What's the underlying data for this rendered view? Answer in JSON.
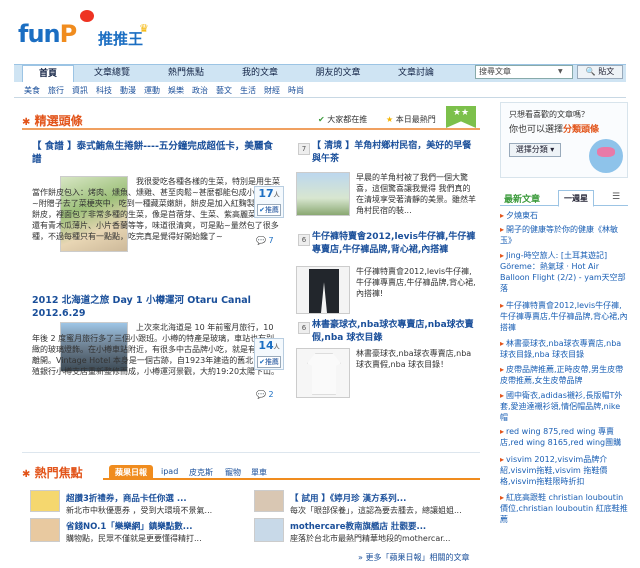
{
  "logo": {
    "fun": "fun",
    "p": "P",
    "zh": "推推王"
  },
  "nav": {
    "tabs": [
      "首頁",
      "文章總覽",
      "熱門焦點",
      "我的文章",
      "朋友的文章",
      "文章討論"
    ],
    "search_placeholder": "搜尋文章",
    "search_button": "貼文"
  },
  "subnav": [
    "美食",
    "旅行",
    "資訊",
    "科技",
    "動漫",
    "運動",
    "娛樂",
    "政治",
    "藝文",
    "生活",
    "財經",
    "時尚"
  ],
  "featured": {
    "heading": "精選頭條",
    "link_all": "大家都在推",
    "link_hot": "本日最熱門"
  },
  "articles": [
    {
      "title": "【 食譜 】泰式鮪魚生捲餅----五分鐘完成超低卡，美麗食譜",
      "body": "我很愛吃各種各樣的生菜，特別是用生菜當作餅皮包入：烤肉、燻魚、燻雞、甚至肉鬆~甚麼都能包成小包包捲~附贈子去了菜梗夾中，吃到一種藏菜嫩餅，餅皮是加入紅麴製作的調餅皮，裡面包了非常多種的生菜，像是苜蓿芽、生菜、紫高麗菜，甚至還有青木瓜薄片、小片香蘭等等，味道很清爽，可是點~量然包了很多種，不過每種只有一點點，吃完真是覺得好開始饞了~",
      "votes": "17",
      "unit": "人",
      "push": "推薦",
      "comments": "7"
    },
    {
      "title": "2012 北海道之旅 Day 1 小樽運河 Otaru Canal 2012.6.29",
      "body": "上次來北海道是 10 年前蜜月旅行，10 年後 2 度蜜月旅行多了三個小跟班。小樽的特產是玻璃，車站也有別緻的玻璃燈飾。在小樽車站附近，有很多中古品牌小吃，就是有點不想離開。Vintage Hotel 本身是一個古跡，自1923年建造的舊北海道拓殖銀行小樽支店重新整修而成，小樽運河景觀，大約19:20太陽下山。",
      "votes": "14",
      "unit": "人",
      "push": "推薦",
      "comments": "2"
    }
  ],
  "side_articles": [
    {
      "rank": "7",
      "title": "【 清境 】羊角村鄉村民宿，美好的早餐與午茶",
      "body": "早晨的羊角村被了我們一個大驚喜，這個驚喜讓我覺得 我們真的在清境享受著清靜的美景。雖然羊角村民宿的裝..."
    },
    {
      "rank": "6",
      "title": "牛仔褲特賣會2012,levis牛仔褲,牛仔褲專賣店,牛仔褲品牌,背心裙,內搭褲",
      "body": "牛仔褲特賣會2012,levis牛仔褲,牛仔褲專賣店,牛仔褲品牌,背心裙,內搭褲!"
    },
    {
      "rank": "6",
      "title": "林書豪球衣,nba球衣專賣店,nba球衣賣假,nba 球衣目錄",
      "body": "林書豪球衣,nba球衣專賣店,nba球衣賣假,nba 球衣目錄！"
    }
  ],
  "hot": {
    "heading": "熱門焦點",
    "tabs": [
      "蘋果日報",
      "ipad",
      "皮克斯",
      "寵物",
      "單車"
    ],
    "items": [
      {
        "title": "超讚3折禮券，商品卡任你選 ...",
        "body": "新北市中秋優惠券 ，受到大環境不景氣..."
      },
      {
        "title": "省錢NO.1「樂樂網」鎮樂點數...",
        "body": "購物點，民眾不僅就是更要懂得精打..."
      },
      {
        "title": "【 試用 】《婷月珍 漢方系列...",
        "body": "每次「眼部保養」，這認為要去腫去，總讓姐姐..."
      },
      {
        "title": "mothercare教南旗艦店 壯觀要...",
        "body": "座落於台北市最熱門精華地段的mothercar..."
      }
    ],
    "more": "更多「蘋果日報」相關的文章"
  },
  "sidebar": {
    "promo_q1": "只想看喜歡的文章嗎？",
    "promo_q2": "你也可以選擇",
    "promo_brand": "分類頭條",
    "promo_select": "選擇分類",
    "tab_new": "最新文章",
    "tab_week": "一週星",
    "tab_grid": "☰",
    "list": [
      "夕燒東石",
      "開子的健康等於你的健康《林敏玉》",
      "Jing-時空旅人: [土耳其遊記] Göreme：熱氣球 · Hot Air Balloon Flight (2/2) - yam天空部落",
      "牛仔褲特賣會2012,levis牛仔褲,牛仔褲專賣店,牛仔褲品牌,背心裙,內搭褲",
      "林書豪球衣,nba球衣專賣店,nba 球衣目錄,nba 球衣目錄",
      "皮帶品牌推薦,正時皮帶,男生皮帶皮帶推薦,女生皮帶品牌",
      "國中衛衣,adidas襯衫,長版帽T外套,愛迪達襯衫領,情侶帽品牌,nike帽",
      "red wing 875,red wing 專賣店,red wing 8165,red wing團購",
      "visvim 2012,visvim品牌介紹,visvim拖鞋,visvim 拖鞋價格,visvim拖鞋限時折扣",
      "紅底高跟鞋 christian louboutin價位,christian louboutin 紅底鞋推薦"
    ]
  }
}
